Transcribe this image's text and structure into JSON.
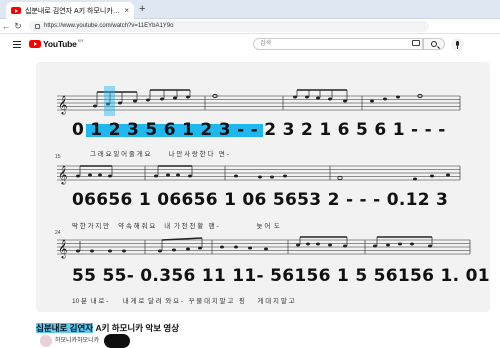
{
  "browser": {
    "tab_title": "십분내로 김연자 A키 하모니카 악보 |",
    "tab_close": "×",
    "new_tab": "+",
    "url": "https://www.youtube.com/watch?v=11EYbA1Y9o"
  },
  "youtube": {
    "logo_text": "YouTube",
    "region": "KR",
    "search_placeholder": "검색"
  },
  "sheet": {
    "measure_numbers": [
      "15",
      "24"
    ],
    "line1": {
      "notation": "0 1 2 3 5 6 1 2 3 - -   2 3 2 1 6  5 6 1 - - -",
      "lyrics": "그 래 요 밑 어 줄 게 요          나 만 사 랑 한 다   면 -"
    },
    "line2": {
      "notation": "06656 1  06656 1  06 5653  2 - - -   0.12 3",
      "lyrics": "딱 한 가 지 만     약 속 해 줘 요     내  가 천 천 황   팬 -                     늦 어  도"
    },
    "line3": {
      "notation": "55 55- 0.356 11 11- 56156 1 5 56156 1. 01",
      "lyrics": "10 분  내 로 -        내 게 로  달 려  와 요 -   꾸 물 대 지 말 고   핑       게 대 지 말 고"
    }
  },
  "video": {
    "title_highlight": "십분내로 김연자",
    "title_rest": " A키 하모니카 악보 영상",
    "channel_text": "하모니카하모니카"
  },
  "colors": {
    "highlight": "#1eb7ef",
    "youtube_red": "#ff0000"
  }
}
